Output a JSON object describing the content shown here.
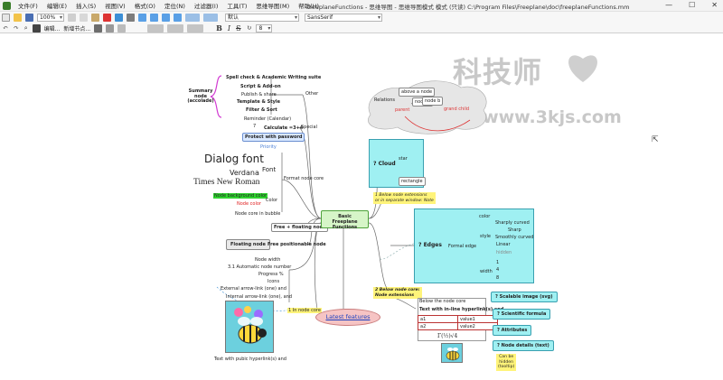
{
  "menubar": {
    "items": [
      "文件(F)",
      "编辑(E)",
      "插入(S)",
      "视图(V)",
      "格式(O)",
      "定位(N)",
      "过滤器(I)",
      "工具(T)",
      "思维导图(M)",
      "帮助(H)"
    ],
    "window_title": "freeplaneFunctions - 思维导图 - 思维导图模式 模式 (只读) C:\\Program Files\\Freeplane\\doc\\freeplaneFunctions.mm",
    "window_buttons": [
      "—",
      "☐",
      "✕"
    ]
  },
  "toolbar": {
    "zoom_value": "100%",
    "style_value": "默认",
    "font_value": "SansSerif",
    "size_value": "8",
    "edit_label": "编辑...",
    "new_node_label": "新增节点...",
    "bold_glyph": "B",
    "italic_glyph": "I",
    "strike_glyph": "S"
  },
  "watermark": {
    "brand_cn": "科技师",
    "url": "https://www.3kjs.com"
  },
  "mindmap": {
    "root": "Basic Freeplane Functions",
    "summary": "Summary node (accolade)",
    "other": "Other",
    "special": "Special",
    "format_core": "Format node core",
    "spell": "Spell check & Academic Writing suite",
    "script": "Script & Add-on",
    "publish": "Publish & share",
    "template": "Template & Style",
    "filter": "Filter & Sort",
    "reminder": "Reminder (Calendar)",
    "calculate": "Calculate =3+4",
    "calc_result": "7",
    "protect": "Protect with password",
    "priority": "Priority",
    "dialog_font": "Dialog font",
    "font_label": "Font",
    "verdana": "Verdana",
    "times": "Times New Roman",
    "bg_color": "Node background color",
    "node_color": "Node color",
    "color_label": "Color",
    "bubble": "Node core in bubble",
    "free_floating": "Free + floating node",
    "floating": "Floating node",
    "free_positionable": "Free positionable node",
    "node_width": "Node width",
    "auto_number": "3.1 Automatic node number",
    "progress": "Progress %",
    "icons": "Icons",
    "ext_arrow": "External arrow-link (one) and",
    "int_arrow": "Internal arrow-link (one), and",
    "in_node_core": "1 In node core",
    "text_hyperlink": "Text with pubic hyperlink(s) and",
    "latest": "Latest features",
    "relations": "Relations",
    "above_node": "above a node",
    "node_a": "node a",
    "node_b": "node b",
    "parent": "parent",
    "grand_child": "grand child",
    "cloud": "Cloud",
    "star": "star",
    "rectangle": "rectangle",
    "below_ext": "1 Below node extensions\nor in separate window: Note",
    "edges": "Edges",
    "formal_edge": "Formal edge",
    "color_e": "color",
    "sharply_curved": "Sharply curved",
    "sharp": "Sharp",
    "smoothly_curved": "Smoothly curved",
    "linear": "Linear",
    "hidden": "hidden",
    "style_e": "style",
    "width_e": "width",
    "width_values": [
      "1",
      "4",
      "8"
    ],
    "below_core": "2 Below node core:\nNode extensions",
    "below_node_core": "Below the node core",
    "text_hyperlink_2": "Text with in-line hyperlink(s) and",
    "attributes_table": [
      [
        "a1",
        "value1"
      ],
      [
        "a2",
        "value2"
      ]
    ],
    "latex": "\\Gamma\\left(\\frac{1}{2}\\right)",
    "latex_render": "Γ(½)√4",
    "scalable_image": "Scalable image (svg)",
    "formula": "Scientific formula",
    "attributes": "Attributes",
    "node_details": "Node details (text)",
    "can_be_hidden": "Can be\nhidden\n(tooltip)"
  }
}
